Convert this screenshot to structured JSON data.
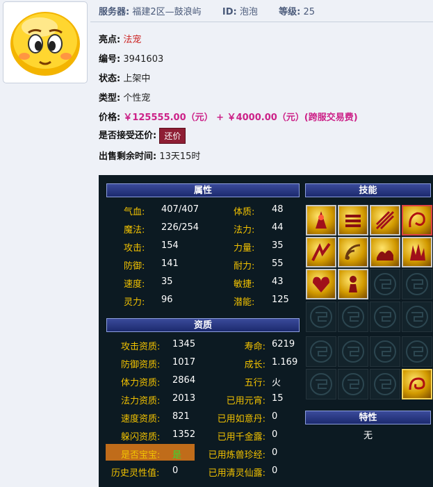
{
  "header": {
    "server_label": "服务器:",
    "server_value": "福建2区—鼓浪屿",
    "id_label": "ID:",
    "id_value": "泡泡",
    "level_label": "等级:",
    "level_value": "25"
  },
  "info": {
    "highlight_label": "亮点:",
    "highlight_value": "法宠",
    "serial_label": "编号:",
    "serial_value": "3941603",
    "status_label": "状态:",
    "status_value": "上架中",
    "type_label": "类型:",
    "type_value": "个性宠",
    "price_label": "价格:",
    "price_value": "￥125555.00（元） + ￥4000.00（元）(跨服交易费)",
    "counter_label": "是否接受还价:",
    "counter_button": "还价",
    "remain_label": "出售剩余时间:",
    "remain_value": "13天15时"
  },
  "attributes": {
    "title": "属性",
    "left": [
      {
        "label": "气血:",
        "value": "407/407"
      },
      {
        "label": "魔法:",
        "value": "226/254"
      },
      {
        "label": "攻击:",
        "value": "154"
      },
      {
        "label": "防御:",
        "value": "141"
      },
      {
        "label": "速度:",
        "value": "35"
      },
      {
        "label": "灵力:",
        "value": "96"
      }
    ],
    "right": [
      {
        "label": "体质:",
        "value": "48"
      },
      {
        "label": "法力:",
        "value": "44"
      },
      {
        "label": "力量:",
        "value": "35"
      },
      {
        "label": "耐力:",
        "value": "55"
      },
      {
        "label": "敏捷:",
        "value": "43"
      },
      {
        "label": "潜能:",
        "value": "125"
      }
    ]
  },
  "aptitude": {
    "title": "资质",
    "left": [
      {
        "label": "攻击资质:",
        "value": "1345"
      },
      {
        "label": "防御资质:",
        "value": "1017"
      },
      {
        "label": "体力资质:",
        "value": "2864"
      },
      {
        "label": "法力资质:",
        "value": "2013"
      },
      {
        "label": "速度资质:",
        "value": "821"
      },
      {
        "label": "躲闪资质:",
        "value": "1352"
      },
      {
        "label": "是否宝宝:",
        "value": "是"
      },
      {
        "label": "历史灵性值:",
        "value": "0"
      }
    ],
    "right": [
      {
        "label": "寿命:",
        "value": "6219"
      },
      {
        "label": "成长:",
        "value": "1.169"
      },
      {
        "label": "五行:",
        "value": "火"
      },
      {
        "label": "已用元宵:",
        "value": "15"
      },
      {
        "label": "已用如意丹:",
        "value": "0"
      },
      {
        "label": "已用千金露:",
        "value": "0"
      },
      {
        "label": "已用炼兽珍经:",
        "value": "0"
      },
      {
        "label": "已用清灵仙露:",
        "value": "0"
      }
    ]
  },
  "skills": {
    "title": "技能",
    "icons": [
      "skill-icon-1",
      "skill-icon-2",
      "skill-icon-3",
      "skill-icon-4",
      "skill-icon-5",
      "skill-icon-6",
      "skill-icon-7",
      "skill-icon-8",
      "skill-icon-9",
      "skill-icon-10",
      "skill-icon-special"
    ]
  },
  "traits": {
    "title": "特性",
    "value": "无"
  },
  "colors": {
    "panel_bg": "#0c1a22",
    "label_yellow": "#f2c200",
    "price_magenta": "#cc2288",
    "highlight_red": "#cc2222",
    "baby_highlight": "#c06c1a",
    "baby_value_green": "#33dd33"
  }
}
